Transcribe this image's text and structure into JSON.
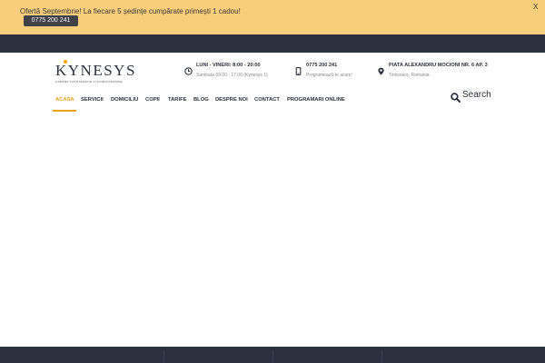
{
  "promo": {
    "text": "Ofertă Septembrie! La fiecare 5 ședințe cumpărate primești 1 cadou!",
    "phone_button": "0775 200 241",
    "close_label": "X"
  },
  "logo": {
    "name": "KYNESYS",
    "tagline": "CABINET FIZIOTERAPIE ȘI KINETOTERAPIE"
  },
  "info": [
    {
      "icon": "clock-icon",
      "title": "LUNI - VINERI: 8:00 - 20:00",
      "subtitle": "Sambata 09:00 - 17:00 (Kynesys 1)"
    },
    {
      "icon": "phone-icon",
      "title": "0775 200 241",
      "subtitle": "Programează-te acum!"
    },
    {
      "icon": "map-pin-icon",
      "title": "PIATA ALEXANDRU MOCIONI NR. 6 AP. 3",
      "subtitle": "Timisoara, Romania"
    }
  ],
  "nav": {
    "items": [
      {
        "label": "ACASA",
        "active": true
      },
      {
        "label": "SERVICII",
        "active": false
      },
      {
        "label": "DOMICILIU",
        "active": false
      },
      {
        "label": "COPII",
        "active": false
      },
      {
        "label": "TARIFE",
        "active": false
      },
      {
        "label": "BLOG",
        "active": false
      },
      {
        "label": "DESPRE NOI",
        "active": false
      },
      {
        "label": "CONTACT",
        "active": false
      },
      {
        "label": "PROGRAMARI ONLINE",
        "active": false
      }
    ]
  },
  "search": {
    "label": "Search"
  },
  "colors": {
    "promo_bg": "#f8cd7b",
    "dark": "#2c2f3e",
    "accent": "#e8a317"
  }
}
